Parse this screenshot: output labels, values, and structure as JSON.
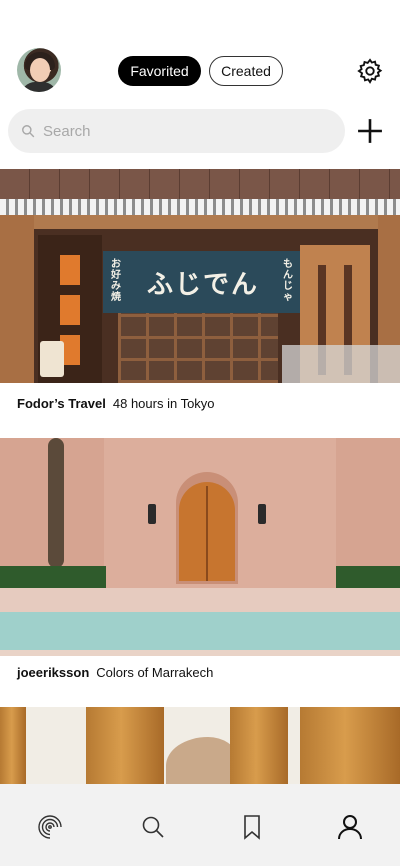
{
  "header": {
    "tabs": [
      {
        "label": "Favorited",
        "active": true
      },
      {
        "label": "Created",
        "active": false
      }
    ]
  },
  "search": {
    "placeholder": "Search"
  },
  "feed": [
    {
      "author": "Fodor’s Travel",
      "title": "48 hours in Tokyo",
      "image_text": {
        "sign": "ふじでん",
        "left": "お好み焼",
        "right": "もんじゃ"
      }
    },
    {
      "author": "joeeriksson",
      "title": "Colors of Marrakech"
    },
    {
      "author": "",
      "title": ""
    }
  ],
  "tabbar": {
    "items": [
      {
        "icon": "feed-icon"
      },
      {
        "icon": "search-icon"
      },
      {
        "icon": "bookmark-icon"
      },
      {
        "icon": "profile-icon",
        "active": true
      }
    ]
  },
  "colors": {
    "accent": "#000000",
    "search_bg": "#efefef",
    "tabbar_bg": "#f2f2f2"
  }
}
